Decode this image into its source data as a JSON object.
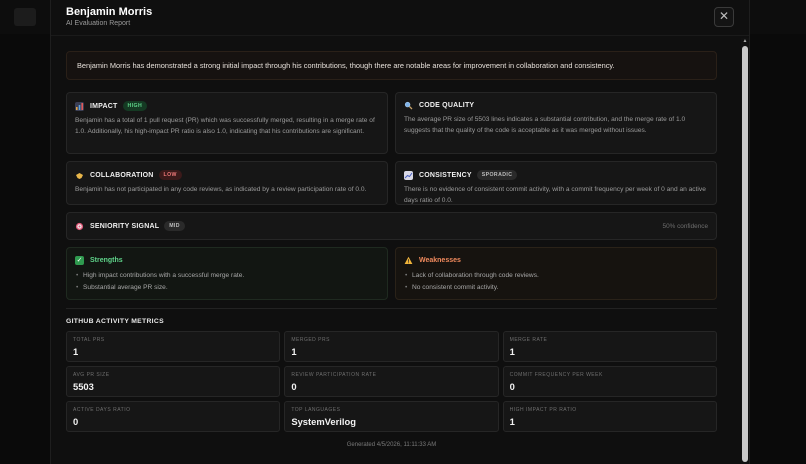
{
  "header": {
    "name": "Benjamin Morris",
    "subtitle": "AI Evaluation Report",
    "close_label": "✕"
  },
  "summary": "Benjamin Morris has demonstrated a strong initial impact through his contributions, though there are notable areas for improvement in collaboration and consistency.",
  "cards": {
    "impact": {
      "title": "IMPACT",
      "badge": "HIGH",
      "body": "Benjamin has a total of 1 pull request (PR) which was successfully merged, resulting in a merge rate of 1.0. Additionally, his high-impact PR ratio is also 1.0, indicating that his contributions are significant."
    },
    "code_quality": {
      "title": "CODE QUALITY",
      "body": "The average PR size of 5503 lines indicates a substantial contribution, and the merge rate of 1.0 suggests that the quality of the code is acceptable as it was merged without issues."
    },
    "collaboration": {
      "title": "COLLABORATION",
      "badge": "LOW",
      "body": "Benjamin has not participated in any code reviews, as indicated by a review participation rate of 0.0."
    },
    "consistency": {
      "title": "CONSISTENCY",
      "badge": "SPORADIC",
      "body": "There is no evidence of consistent commit activity, with a commit frequency per week of 0 and an active days ratio of 0.0."
    }
  },
  "seniority": {
    "title": "SENIORITY SIGNAL",
    "badge": "MID",
    "confidence": "50% confidence"
  },
  "strengths": {
    "title": "Strengths",
    "items": [
      "High impact contributions with a successful merge rate.",
      "Substantial average PR size."
    ]
  },
  "weaknesses": {
    "title": "Weaknesses",
    "items": [
      "Lack of collaboration through code reviews.",
      "No consistent commit activity."
    ]
  },
  "metrics": {
    "title": "GITHUB ACTIVITY METRICS",
    "items": [
      {
        "label": "TOTAL PRS",
        "value": "1"
      },
      {
        "label": "MERGED PRS",
        "value": "1"
      },
      {
        "label": "MERGE RATE",
        "value": "1"
      },
      {
        "label": "AVG PR SIZE",
        "value": "5503"
      },
      {
        "label": "REVIEW PARTICIPATION RATE",
        "value": "0"
      },
      {
        "label": "COMMIT FREQUENCY PER WEEK",
        "value": "0"
      },
      {
        "label": "ACTIVE DAYS RATIO",
        "value": "0"
      },
      {
        "label": "TOP LANGUAGES",
        "value": "SystemVerilog"
      },
      {
        "label": "HIGH IMPACT PR RATIO",
        "value": "1"
      }
    ]
  },
  "footer": "Generated 4/5/2026, 11:11:33 AM",
  "icons": {
    "impact": "bar-chart-icon",
    "code_quality": "magnifier-icon",
    "collaboration": "handshake-icon",
    "consistency": "trend-chart-icon",
    "seniority": "target-icon",
    "strengths": "check-icon",
    "weaknesses": "warning-icon"
  },
  "colors": {
    "strengths": "#5fd48a",
    "weaknesses": "#f08a5d",
    "high": "#5fd48a",
    "low": "#f07a7a"
  }
}
